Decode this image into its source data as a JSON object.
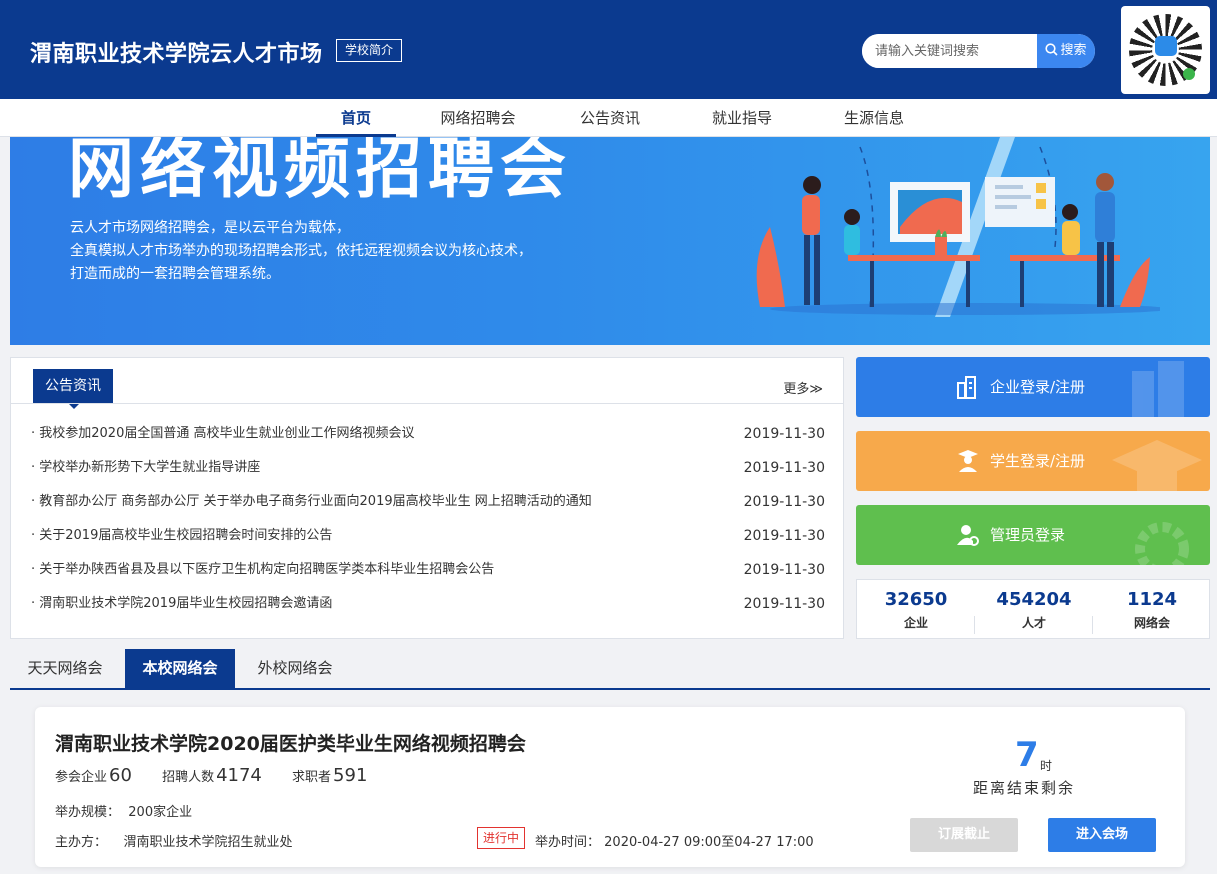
{
  "header": {
    "site_title": "渭南职业技术学院云人才市场",
    "intro_button": "学校简介",
    "search": {
      "placeholder": "请输入关键词搜索",
      "button": "搜索"
    }
  },
  "nav": {
    "items": [
      {
        "label": "首页",
        "active": true
      },
      {
        "label": "网络招聘会",
        "active": false
      },
      {
        "label": "公告资讯",
        "active": false
      },
      {
        "label": "就业指导",
        "active": false
      },
      {
        "label": "生源信息",
        "active": false
      }
    ]
  },
  "banner": {
    "title": "网络视频招聘会",
    "lines": [
      "云人才市场网络招聘会，是以云平台为载体，",
      "全真模拟人才市场举办的现场招聘会形式，依托远程视频会议为核心技术，",
      "打造而成的一套招聘会管理系统。"
    ]
  },
  "notices": {
    "tab_label": "公告资讯",
    "more": "更多≫",
    "items": [
      {
        "title": "· 我校参加2020届全国普通 高校毕业生就业创业工作网络视频会议",
        "date": "2019-11-30"
      },
      {
        "title": "· 学校举办新形势下大学生就业指导讲座",
        "date": "2019-11-30"
      },
      {
        "title": "· 教育部办公厅 商务部办公厅 关于举办电子商务行业面向2019届高校毕业生 网上招聘活动的通知",
        "date": "2019-11-30"
      },
      {
        "title": "· 关于2019届高校毕业生校园招聘会时间安排的公告",
        "date": "2019-11-30"
      },
      {
        "title": "· 关于举办陕西省县及县以下医疗卫生机构定向招聘医学类本科毕业生招聘会公告",
        "date": "2019-11-30"
      },
      {
        "title": "· 渭南职业技术学院2019届毕业生校园招聘会邀请函",
        "date": "2019-11-30"
      }
    ]
  },
  "login": {
    "company": "企业登录/注册",
    "student": "学生登录/注册",
    "admin": "管理员登录"
  },
  "stats": [
    {
      "value": "32650",
      "label": "企业"
    },
    {
      "value": "454204",
      "label": "人才"
    },
    {
      "value": "1124",
      "label": "网络会"
    }
  ],
  "fair_tabs": [
    {
      "label": "天天网络会",
      "active": false
    },
    {
      "label": "本校网络会",
      "active": true
    },
    {
      "label": "外校网络会",
      "active": false
    }
  ],
  "fair": {
    "title": "渭南职业技术学院2020届医护类毕业生网络视频招聘会",
    "companies_label": "参会企业",
    "companies": "60",
    "positions_label": "招聘人数",
    "positions": "4174",
    "seekers_label": "求职者",
    "seekers": "591",
    "scale_label": "举办规模：",
    "scale": "200家企业",
    "organizer_label": "主办方：",
    "organizer": "渭南职业技术学院招生就业处",
    "status": "进行中",
    "time_label": "举办时间：",
    "time": "2020-04-27 09:00至04-27 17:00",
    "remaining_value": "7",
    "remaining_unit": "时",
    "remaining_label": "距离结束剩余",
    "btn_closed": "订展截止",
    "btn_enter": "进入会场"
  },
  "colors": {
    "brand": "#0b3a8f",
    "accent": "#2d7de7",
    "orange": "#f7a94b",
    "green": "#5fbf4e",
    "status_red": "#e2332f"
  }
}
